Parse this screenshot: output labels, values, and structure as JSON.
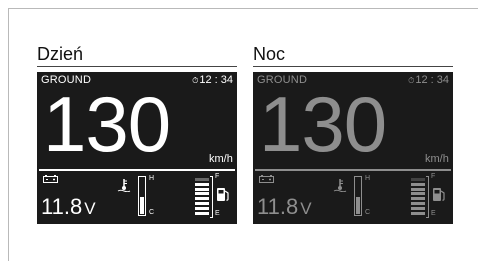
{
  "panels": [
    {
      "title": "Dzień",
      "mode": "GROUND",
      "clock": "12 : 34",
      "clock_icon": "clock-icon",
      "speed": "130",
      "speed_unit": "km/h",
      "voltage": "11.8",
      "voltage_unit": "V",
      "temp_high_label": "H",
      "temp_low_label": "C",
      "fuel_full_label": "F",
      "fuel_empty_label": "E",
      "temp_level": 0.45,
      "fuel_level": 0.85,
      "colors": {
        "text": "#ffffff",
        "screen": "#1a1a1a"
      }
    },
    {
      "title": "Noc",
      "mode": "GROUND",
      "clock": "12 : 34",
      "clock_icon": "clock-icon",
      "speed": "130",
      "speed_unit": "km/h",
      "voltage": "11.8",
      "voltage_unit": "V",
      "temp_high_label": "H",
      "temp_low_label": "C",
      "fuel_full_label": "F",
      "fuel_empty_label": "E",
      "temp_level": 0.45,
      "fuel_level": 0.85,
      "colors": {
        "text": "#8e8e8e",
        "screen": "#1a1a1a"
      }
    }
  ]
}
